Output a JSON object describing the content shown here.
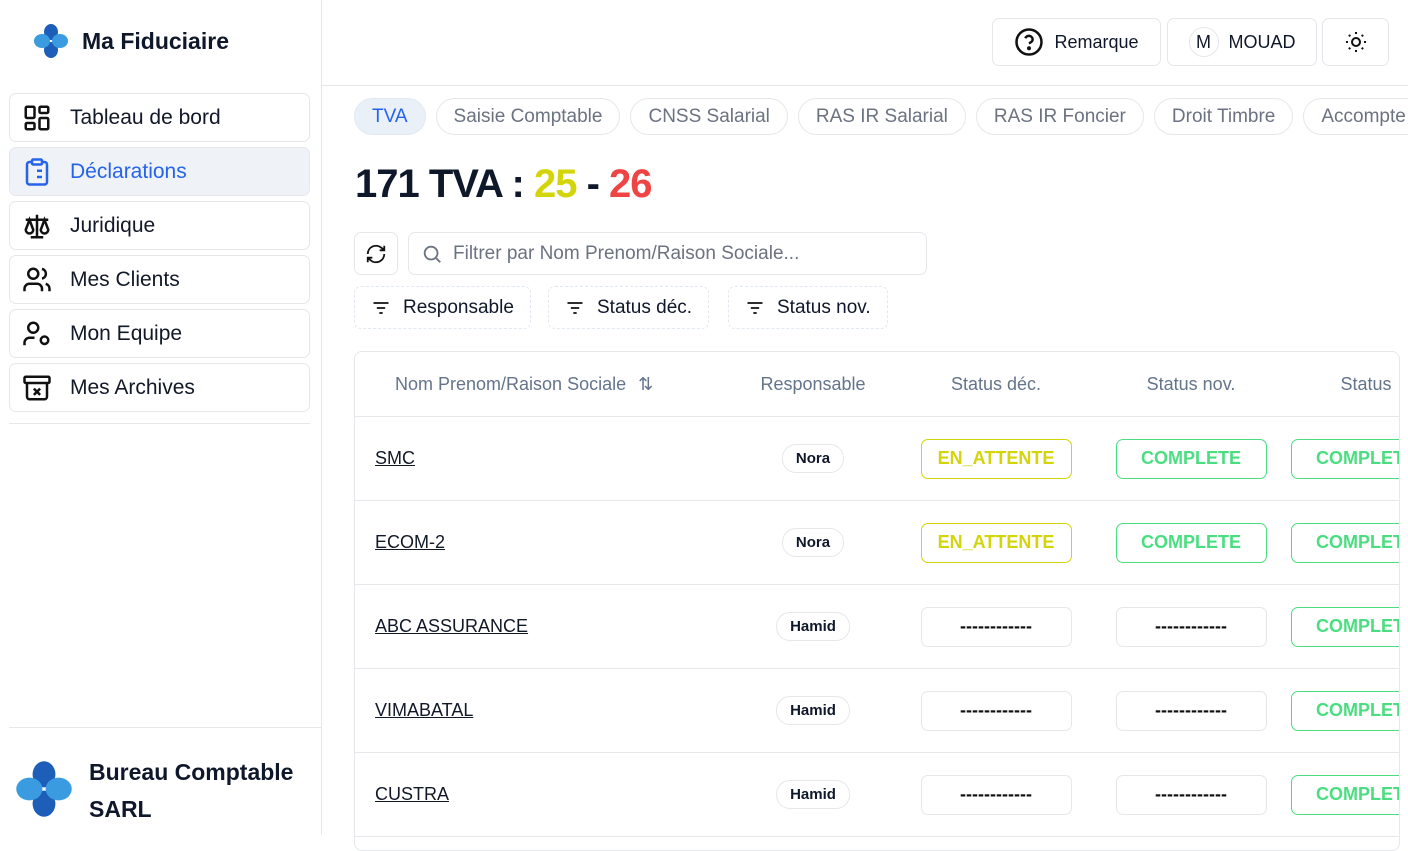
{
  "app": {
    "title": "Ma Fiduciaire"
  },
  "sidebar": {
    "items": [
      {
        "label": "Tableau de bord",
        "icon": "dashboard-icon"
      },
      {
        "label": "Déclarations",
        "icon": "clipboard-list-icon",
        "active": true
      },
      {
        "label": "Juridique",
        "icon": "scale-icon"
      },
      {
        "label": "Mes Clients",
        "icon": "users-icon"
      },
      {
        "label": "Mon Equipe",
        "icon": "user-cog-icon"
      },
      {
        "label": "Mes Archives",
        "icon": "archive-x-icon"
      }
    ],
    "footer": {
      "company_line1": "Bureau Comptable",
      "company_line2": "SARL"
    }
  },
  "header": {
    "remarque": "Remarque",
    "user_initial": "M",
    "user_name": "MOUAD"
  },
  "tabs": [
    "TVA",
    "Saisie Comptable",
    "CNSS Salarial",
    "RAS IR Salarial",
    "RAS IR Foncier",
    "Droit Timbre",
    "Accompte"
  ],
  "page": {
    "count": "171 TVA :",
    "sep": "-",
    "a": "25",
    "b": "26",
    "color_a": "#d4d40a",
    "color_b": "#ef4444"
  },
  "search": {
    "placeholder": "Filtrer par Nom Prenom/Raison Sociale...",
    "value": ""
  },
  "filters": [
    "Responsable",
    "Status déc.",
    "Status nov."
  ],
  "table": {
    "headers": [
      "Nom Prenom/Raison Sociale",
      "Responsable",
      "Status déc.",
      "Status nov.",
      "Status"
    ],
    "rows": [
      {
        "name": "SMC",
        "resp": "Nora",
        "dec": "EN_ATTENTE",
        "nov": "COMPLETE",
        "status": "COMPLETE"
      },
      {
        "name": "ECOM-2",
        "resp": "Nora",
        "dec": "EN_ATTENTE",
        "nov": "COMPLETE",
        "status": "COMPLETE"
      },
      {
        "name": "ABC ASSURANCE",
        "resp": "Hamid",
        "dec": "------------",
        "nov": "------------",
        "status": "COMPLETE"
      },
      {
        "name": "VIMABATAL",
        "resp": "Hamid",
        "dec": "------------",
        "nov": "------------",
        "status": "COMPLETE"
      },
      {
        "name": "CUSTRA",
        "resp": "Hamid",
        "dec": "------------",
        "nov": "------------",
        "status": "COMPLETE"
      }
    ]
  },
  "colors": {
    "accent": "#2563eb",
    "pending": "#d4d40a",
    "complete": "#4ade80"
  }
}
